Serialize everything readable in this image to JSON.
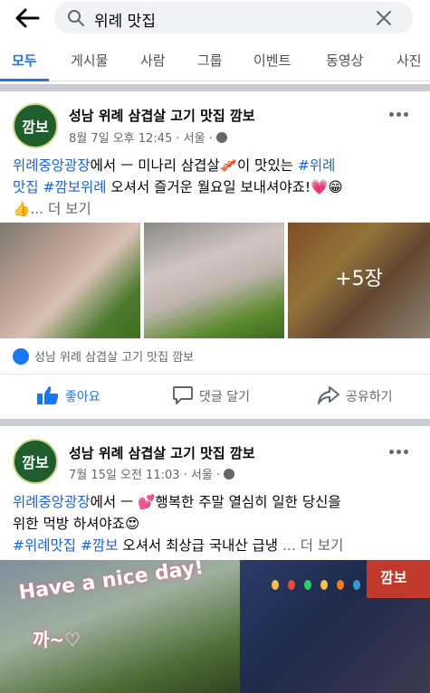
{
  "search": {
    "query": "위례 맛집"
  },
  "tabs": [
    {
      "label": "모두"
    },
    {
      "label": "게시물"
    },
    {
      "label": "사람"
    },
    {
      "label": "그룹"
    },
    {
      "label": "이벤트"
    },
    {
      "label": "동영상"
    },
    {
      "label": "사진"
    }
  ],
  "posts": [
    {
      "page_name": "성남 위례 삼겹살 고기 맛집 깜보",
      "avatar_text": "깜보",
      "time": "8월 7일 오후 12:45",
      "location": "서울",
      "text_line1_link": "위례중앙광장",
      "text_line1_rest": "에서 ㅡ 미나리 삼겹살",
      "text_line1_emoji": "🥓",
      "text_line1_tail": "이 맛있는 ",
      "text_line1_tag": "#위례",
      "text_line2_tag1": "맛집",
      "text_line2_tag2": "#깜보위례",
      "text_line2_rest": " 오셔서 즐거운 월요일 보내셔야죠!",
      "text_line2_emoji": "💗😁",
      "text_line3_emoji": "👍",
      "see_more": "... 더 보기",
      "more_photos": "+5장",
      "page_link": "성남 위례 삼겹살 고기 맛집 깜보",
      "actions": {
        "like": "좋아요",
        "comment": "댓글 달기",
        "share": "공유하기"
      }
    },
    {
      "page_name": "성남 위례 삼겹살 고기 맛집 깜보",
      "avatar_text": "깜보",
      "time": "7월 15일 오전 11:03",
      "location": "서울",
      "text_line1_link": "위례중앙광장",
      "text_line1_rest": "에서 ㅡ ",
      "text_line1_emoji": "💕",
      "text_line1_tail": "행복한 주말 열심히 일한 당신을",
      "text_line2_rest": "위한 먹방 하셔야죠",
      "text_line2_emoji": "😍",
      "text_line3_tag1": "#위례맛집",
      "text_line3_tag2": "#깜보",
      "text_line3_rest": " 오셔서 최상급 국내산 급냉 ",
      "see_more": "... 더 보기",
      "photo_text1": "Have a nice day!",
      "photo_text2": "까~♡",
      "photo_sign": "깜보"
    }
  ]
}
